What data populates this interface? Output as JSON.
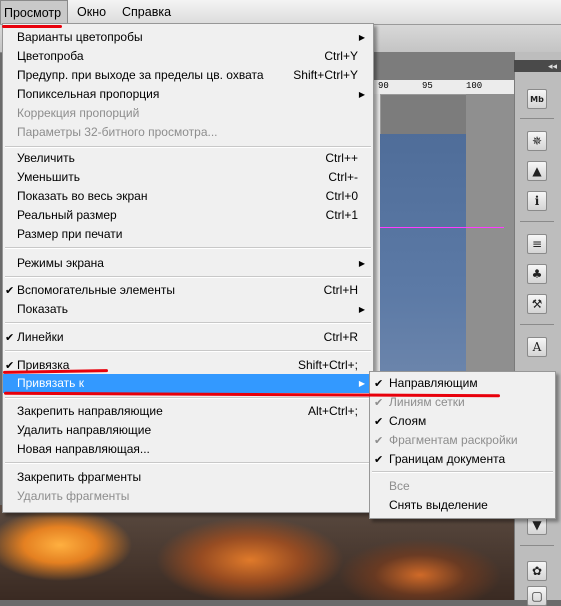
{
  "menubar": {
    "view": "Просмотр",
    "window": "Окно",
    "help": "Справка"
  },
  "ruler": {
    "ticks": [
      "90",
      "95",
      "100"
    ]
  },
  "view_menu": {
    "items": [
      {
        "label": "Варианты цветопробы",
        "shortcut": "",
        "submenu": true,
        "disabled": false,
        "checked": false
      },
      {
        "label": "Цветопроба",
        "shortcut": "Ctrl+Y",
        "submenu": false,
        "disabled": false,
        "checked": false
      },
      {
        "label": "Предупр. при выходе за пределы цв. охвата",
        "shortcut": "Shift+Ctrl+Y",
        "submenu": false,
        "disabled": false,
        "checked": false
      },
      {
        "label": "Попиксельная пропорция",
        "shortcut": "",
        "submenu": true,
        "disabled": false,
        "checked": false
      },
      {
        "label": "Коррекция пропорций",
        "shortcut": "",
        "submenu": false,
        "disabled": true,
        "checked": false
      },
      {
        "label": "Параметры 32-битного просмотра...",
        "shortcut": "",
        "submenu": false,
        "disabled": true,
        "checked": false
      },
      {
        "label": "Увеличить",
        "shortcut": "Ctrl++",
        "submenu": false,
        "disabled": false,
        "checked": false
      },
      {
        "label": "Уменьшить",
        "shortcut": "Ctrl+-",
        "submenu": false,
        "disabled": false,
        "checked": false
      },
      {
        "label": "Показать во весь экран",
        "shortcut": "Ctrl+0",
        "submenu": false,
        "disabled": false,
        "checked": false
      },
      {
        "label": "Реальный размер",
        "shortcut": "Ctrl+1",
        "submenu": false,
        "disabled": false,
        "checked": false
      },
      {
        "label": "Размер при печати",
        "shortcut": "",
        "submenu": false,
        "disabled": false,
        "checked": false
      },
      {
        "label": "Режимы экрана",
        "shortcut": "",
        "submenu": true,
        "disabled": false,
        "checked": false
      },
      {
        "label": "Вспомогательные элементы",
        "shortcut": "Ctrl+H",
        "submenu": false,
        "disabled": false,
        "checked": true
      },
      {
        "label": "Показать",
        "shortcut": "",
        "submenu": true,
        "disabled": false,
        "checked": false
      },
      {
        "label": "Линейки",
        "shortcut": "Ctrl+R",
        "submenu": false,
        "disabled": false,
        "checked": true
      },
      {
        "label": "Привязка",
        "shortcut": "Shift+Ctrl+;",
        "submenu": false,
        "disabled": false,
        "checked": true
      },
      {
        "label": "Привязать к",
        "shortcut": "",
        "submenu": true,
        "disabled": false,
        "checked": false,
        "highlighted": true
      },
      {
        "label": "Закрепить направляющие",
        "shortcut": "Alt+Ctrl+;",
        "submenu": false,
        "disabled": false,
        "checked": false
      },
      {
        "label": "Удалить направляющие",
        "shortcut": "",
        "submenu": false,
        "disabled": false,
        "checked": false
      },
      {
        "label": "Новая направляющая...",
        "shortcut": "",
        "submenu": false,
        "disabled": false,
        "checked": false
      },
      {
        "label": "Закрепить фрагменты",
        "shortcut": "",
        "submenu": false,
        "disabled": false,
        "checked": false
      },
      {
        "label": "Удалить фрагменты",
        "shortcut": "",
        "submenu": false,
        "disabled": true,
        "checked": false
      }
    ]
  },
  "snap_submenu": {
    "items": [
      {
        "label": "Направляющим",
        "checked": true,
        "disabled": false
      },
      {
        "label": "Линиям сетки",
        "checked": true,
        "disabled": true
      },
      {
        "label": "Слоям",
        "checked": true,
        "disabled": false
      },
      {
        "label": "Фрагментам раскройки",
        "checked": true,
        "disabled": true
      },
      {
        "label": "Границам документа",
        "checked": true,
        "disabled": false
      },
      {
        "label": "Все",
        "checked": false,
        "disabled": true
      },
      {
        "label": "Снять выделение",
        "checked": false,
        "disabled": false
      }
    ]
  },
  "panel": {
    "collapse_label": "◂◂",
    "tools": [
      "mini-bridge-icon",
      "navigator-icon",
      "histogram-icon",
      "info-icon",
      "brush-presets-icon",
      "clone-source-icon",
      "tool-presets-icon",
      "character-icon",
      "layer-comps-icon",
      "styles-icon",
      "page-icon"
    ]
  },
  "colors": {
    "menu_bg": "#f0f0f0",
    "highlight": "#3399ff",
    "disabled_text": "#8d8d8d",
    "annotation_red": "#e8000b",
    "guide": "#ff3cff"
  }
}
